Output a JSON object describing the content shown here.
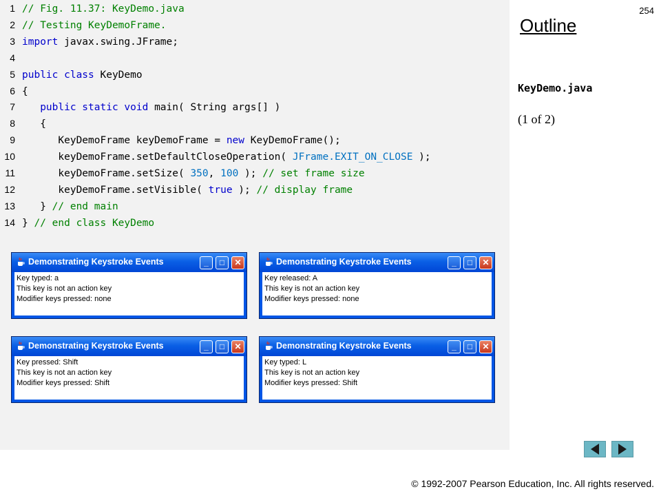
{
  "slide": {
    "page_number": "254",
    "outline_title": "Outline",
    "file_name": "KeyDemo.java",
    "part_label": "(1 of 2)",
    "copyright": "© 1992-2007 Pearson Education, Inc.  All rights reserved."
  },
  "code": [
    {
      "n": "1",
      "tokens": [
        {
          "c": "comment",
          "t": "// Fig. 11.37: KeyDemo.java"
        }
      ]
    },
    {
      "n": "2",
      "tokens": [
        {
          "c": "comment",
          "t": "// Testing KeyDemoFrame."
        }
      ]
    },
    {
      "n": "3",
      "tokens": [
        {
          "c": "keyword",
          "t": "import"
        },
        {
          "c": "plain",
          "t": " javax.swing.JFrame;"
        }
      ]
    },
    {
      "n": "4",
      "tokens": []
    },
    {
      "n": "5",
      "tokens": [
        {
          "c": "keyword",
          "t": "public class"
        },
        {
          "c": "plain",
          "t": " KeyDemo"
        }
      ]
    },
    {
      "n": "6",
      "tokens": [
        {
          "c": "plain",
          "t": "{"
        }
      ]
    },
    {
      "n": "7",
      "tokens": [
        {
          "c": "plain",
          "t": "   "
        },
        {
          "c": "keyword",
          "t": "public static void"
        },
        {
          "c": "plain",
          "t": " main( String args[] )"
        }
      ]
    },
    {
      "n": "8",
      "tokens": [
        {
          "c": "plain",
          "t": "   {"
        }
      ]
    },
    {
      "n": "9",
      "tokens": [
        {
          "c": "plain",
          "t": "      KeyDemoFrame keyDemoFrame = "
        },
        {
          "c": "keyword",
          "t": "new"
        },
        {
          "c": "plain",
          "t": " KeyDemoFrame();"
        }
      ]
    },
    {
      "n": "10",
      "tokens": [
        {
          "c": "plain",
          "t": "      keyDemoFrame.setDefaultCloseOperation( "
        },
        {
          "c": "const",
          "t": "JFrame.EXIT_ON_CLOSE"
        },
        {
          "c": "plain",
          "t": " );"
        }
      ]
    },
    {
      "n": "11",
      "tokens": [
        {
          "c": "plain",
          "t": "      keyDemoFrame.setSize( "
        },
        {
          "c": "const",
          "t": "350"
        },
        {
          "c": "plain",
          "t": ", "
        },
        {
          "c": "const",
          "t": "100"
        },
        {
          "c": "plain",
          "t": " ); "
        },
        {
          "c": "comment",
          "t": "// set frame size"
        }
      ]
    },
    {
      "n": "12",
      "tokens": [
        {
          "c": "plain",
          "t": "      keyDemoFrame.setVisible( "
        },
        {
          "c": "keyword",
          "t": "true"
        },
        {
          "c": "plain",
          "t": " ); "
        },
        {
          "c": "comment",
          "t": "// display frame"
        }
      ]
    },
    {
      "n": "13",
      "tokens": [
        {
          "c": "plain",
          "t": "   } "
        },
        {
          "c": "comment",
          "t": "// end main"
        }
      ]
    },
    {
      "n": "14",
      "tokens": [
        {
          "c": "plain",
          "t": "} "
        },
        {
          "c": "comment",
          "t": "// end class KeyDemo"
        }
      ]
    }
  ],
  "windows": [
    {
      "title": "Demonstrating Keystroke Events",
      "lines": [
        "Key typed: a",
        "This key is not an action key",
        "Modifier keys pressed: none"
      ]
    },
    {
      "title": "Demonstrating Keystroke Events",
      "lines": [
        "Key released: A",
        "This key is not an action key",
        "Modifier keys pressed: none"
      ]
    },
    {
      "title": "Demonstrating Keystroke Events",
      "lines": [
        "Key pressed: Shift",
        "This key is not an action key",
        "Modifier keys pressed: Shift"
      ]
    },
    {
      "title": "Demonstrating Keystroke Events",
      "lines": [
        "Key typed: L",
        "This key is not an action key",
        "Modifier keys pressed: Shift"
      ]
    }
  ],
  "window_buttons": {
    "minimize": "minimize-icon",
    "maximize": "maximize-icon",
    "close": "close-icon"
  },
  "navigation": {
    "prev": "previous-slide-icon",
    "next": "next-slide-icon"
  }
}
